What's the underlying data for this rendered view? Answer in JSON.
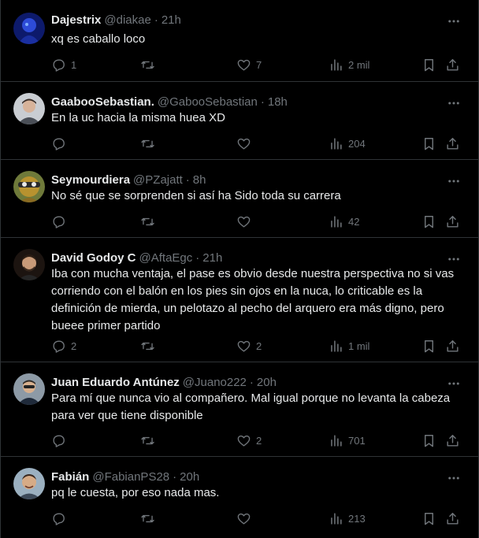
{
  "replies": [
    {
      "name": "Dajestrix",
      "handle": "@diakae",
      "time": "21h",
      "text": "xq es caballo loco",
      "reply_count": "1",
      "retweet_count": "",
      "like_count": "7",
      "view_count": "2 mil",
      "avatar": "avatar-dajestrix"
    },
    {
      "name": "GaabooSebastian.",
      "handle": "@GabooSebastian",
      "time": "18h",
      "text": "En la uc hacia la misma huea XD",
      "reply_count": "",
      "retweet_count": "",
      "like_count": "",
      "view_count": "204",
      "avatar": "avatar-gaaboo"
    },
    {
      "name": "Seymourdiera",
      "handle": "@PZajatt",
      "time": "8h",
      "text": "No sé que se sorprenden si así ha Sido toda su carrera",
      "reply_count": "",
      "retweet_count": "",
      "like_count": "",
      "view_count": "42",
      "avatar": "avatar-seymour"
    },
    {
      "name": "David Godoy C",
      "handle": "@AftaEgc",
      "time": "21h",
      "text": "Iba con mucha ventaja, el pase es obvio desde nuestra perspectiva no si vas corriendo con el balón en los pies sin ojos en la nuca, lo criticable es la definición de mierda, un pelotazo al pecho del arquero era más digno, pero bueee primer partido",
      "reply_count": "2",
      "retweet_count": "",
      "like_count": "2",
      "view_count": "1 mil",
      "avatar": "avatar-david"
    },
    {
      "name": "Juan Eduardo Antúnez",
      "handle": "@Juano222",
      "time": "20h",
      "text": "Para mí que nunca vio al compañero. Mal igual porque no levanta la cabeza para ver que tiene disponible",
      "reply_count": "",
      "retweet_count": "",
      "like_count": "2",
      "view_count": "701",
      "avatar": "avatar-juan"
    },
    {
      "name": "Fabián",
      "handle": "@FabianPS28",
      "time": "20h",
      "text": "pq le cuesta, por eso nada mas.",
      "reply_count": "",
      "retweet_count": "",
      "like_count": "",
      "view_count": "213",
      "avatar": "avatar-fabian"
    }
  ],
  "separator": "·",
  "colors": {
    "background": "#000000",
    "text": "#e7e9ea",
    "muted": "#71767b",
    "border": "#2f3336"
  }
}
